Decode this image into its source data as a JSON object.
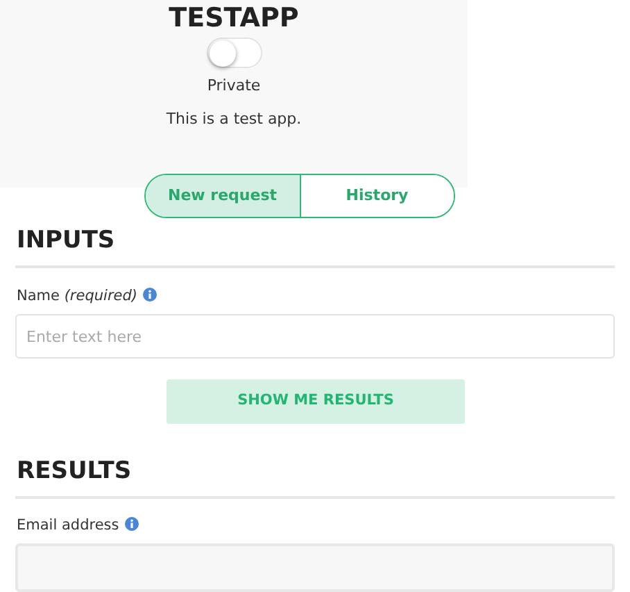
{
  "app": {
    "title": "TESTAPP",
    "private_toggle": {
      "on": false
    },
    "visibility": "Private",
    "description": "This is a test app."
  },
  "tabs": [
    {
      "label": "New request",
      "selected": true
    },
    {
      "label": "History",
      "selected": false
    }
  ],
  "inputs": {
    "heading": "INPUTS",
    "fields": [
      {
        "label": "Name *(required)*",
        "placeholder": "Enter text here"
      }
    ],
    "submit": "SHOW ME RESULTS"
  },
  "results": {
    "heading": "RESULTS",
    "fields": [
      {
        "label": "Email address"
      }
    ]
  }
}
